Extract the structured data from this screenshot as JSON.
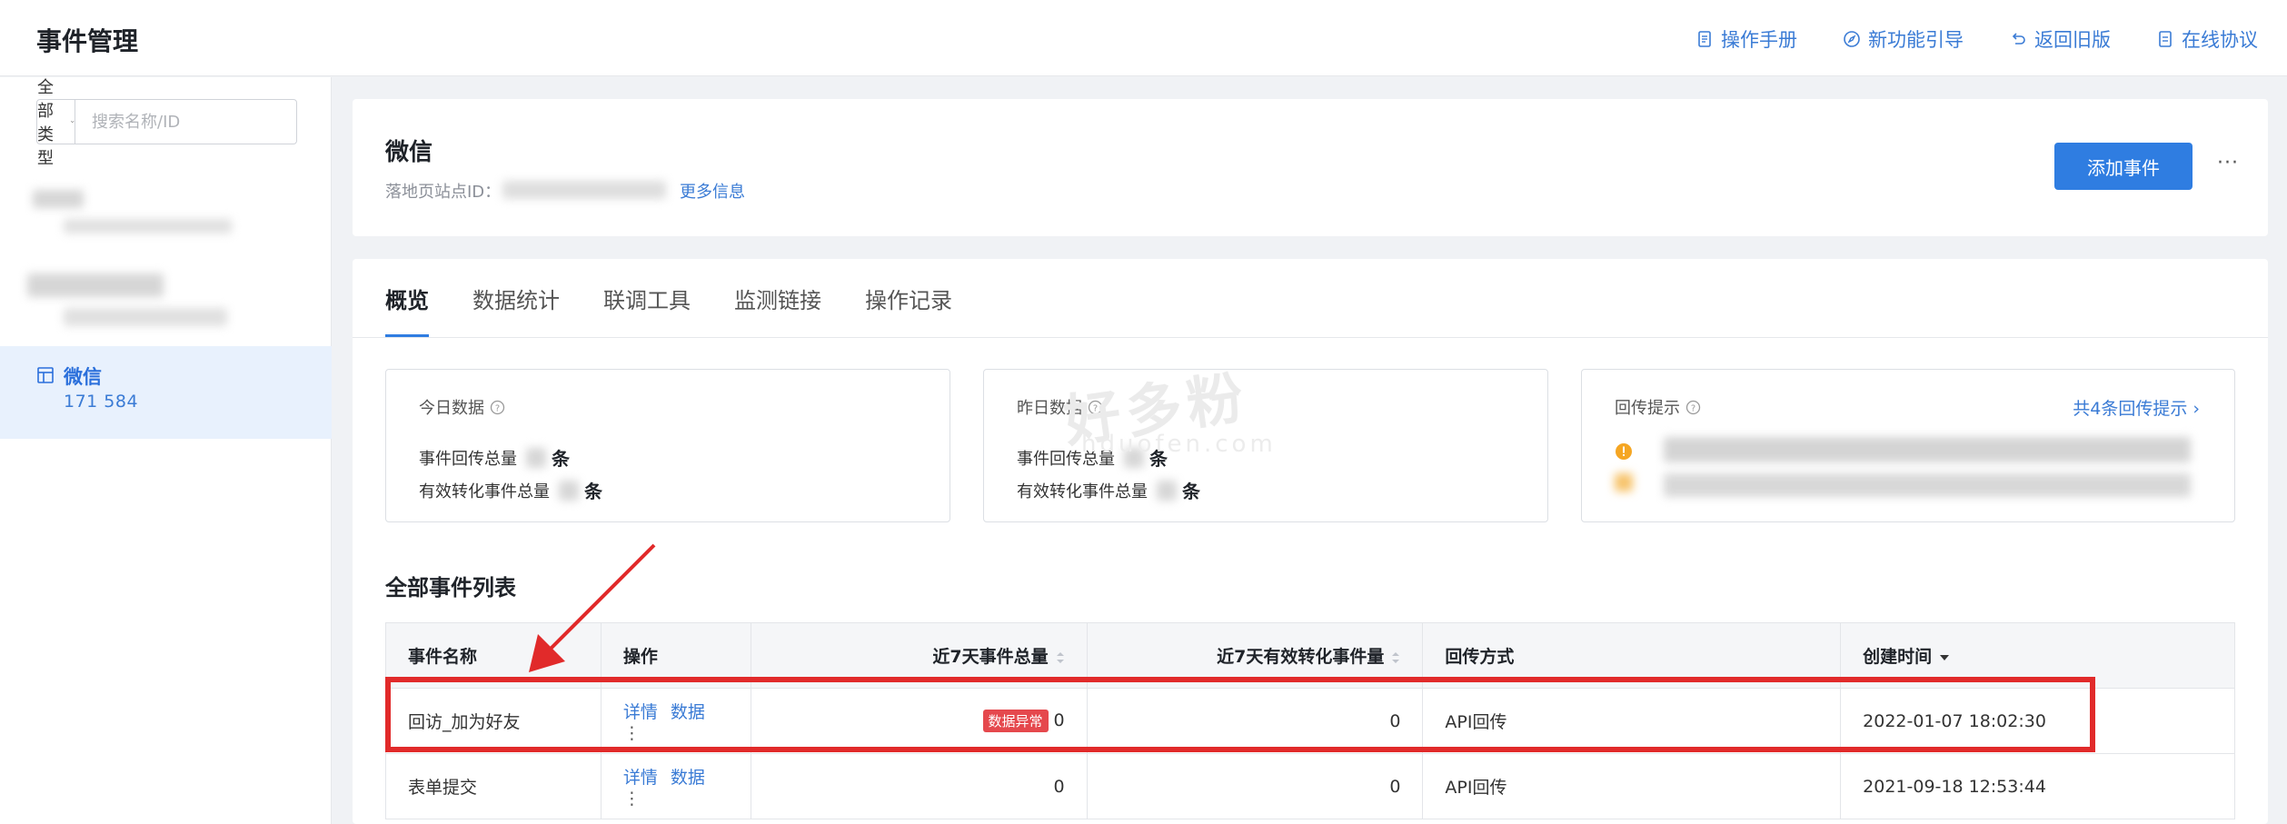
{
  "header": {
    "title": "事件管理",
    "links": [
      {
        "label": "操作手册",
        "icon": "document-icon"
      },
      {
        "label": "新功能引导",
        "icon": "compass-icon"
      },
      {
        "label": "返回旧版",
        "icon": "undo-icon"
      },
      {
        "label": "在线协议",
        "icon": "file-icon"
      }
    ]
  },
  "sidebar": {
    "filter": {
      "type_label": "全部类型",
      "search_placeholder": "搜索名称/ID"
    },
    "active_item": {
      "name": "微信",
      "id": "171                 584"
    }
  },
  "page": {
    "title": "微信",
    "site_label": "落地页站点ID：",
    "more_info": "更多信息",
    "add_button": "添加事件",
    "more_button": "···"
  },
  "tabs": [
    "概览",
    "数据统计",
    "联调工具",
    "监测链接",
    "操作记录"
  ],
  "stats": {
    "today": {
      "title": "今日数据",
      "rows": [
        {
          "label": "事件回传总量",
          "value": "条"
        },
        {
          "label": "有效转化事件总量",
          "value": "条"
        }
      ]
    },
    "yesterday": {
      "title": "昨日数据",
      "rows": [
        {
          "label": "事件回传总量",
          "value": "条"
        },
        {
          "label": "有效转化事件总量",
          "value": "条"
        }
      ]
    },
    "hints": {
      "title": "回传提示",
      "link": "共4条回传提示 ›"
    }
  },
  "watermark": {
    "main": "好多粉",
    "sub": "hduofen.com"
  },
  "events_table": {
    "title": "全部事件列表",
    "columns": [
      "事件名称",
      "操作",
      "近7天事件总量",
      "近7天有效转化事件量",
      "回传方式",
      "创建时间"
    ],
    "detail_label": "详情",
    "data_label": "数据",
    "rows": [
      {
        "name": "回访_加为好友",
        "badge": "数据异常",
        "total7": "0",
        "valid7": "0",
        "method": "API回传",
        "created": "2022-01-07 18:02:30"
      },
      {
        "name": "表单提交",
        "badge": "",
        "total7": "0",
        "valid7": "0",
        "method": "API回传",
        "created": "2021-09-18 12:53:44"
      }
    ]
  },
  "colors": {
    "accent": "#2f7de1",
    "link": "#3a7bd5",
    "annotation": "#e12a2a",
    "badge": "#e5484d"
  }
}
